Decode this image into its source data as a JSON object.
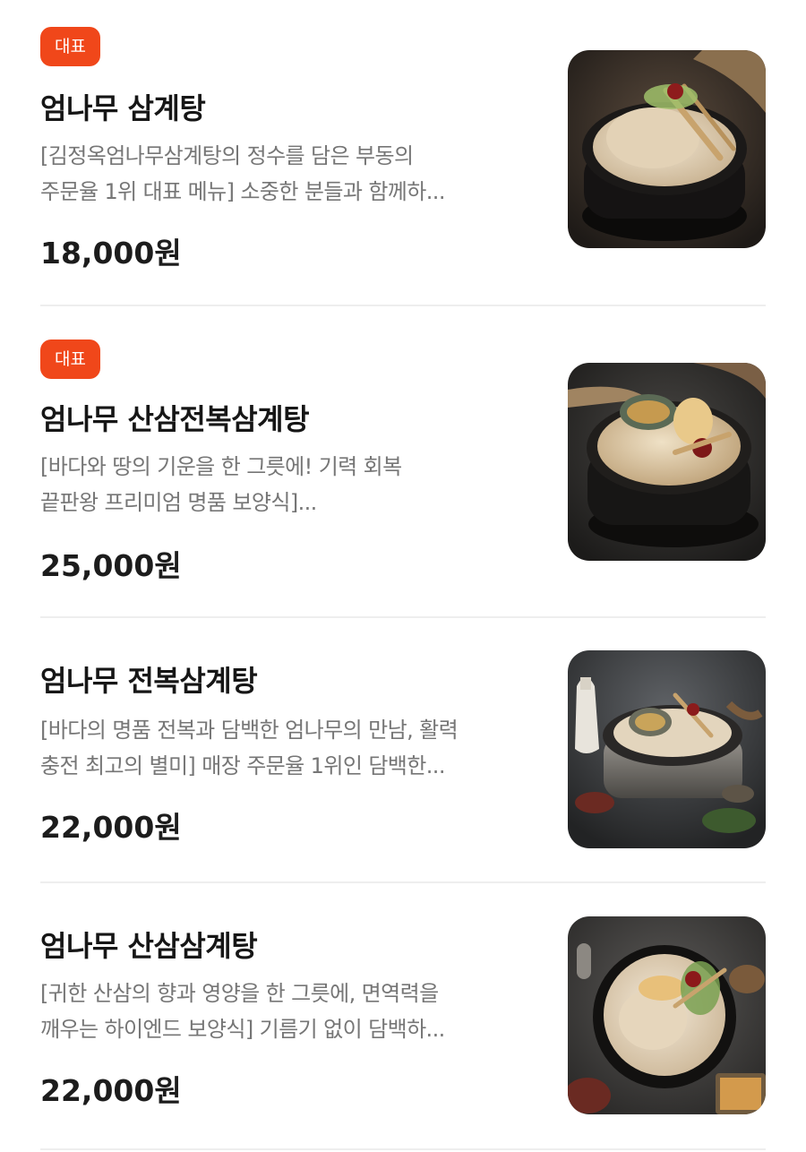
{
  "menu_items": [
    {
      "badge": "대표",
      "name": "엄나무 삼계탕",
      "desc_line1": "[김정옥엄나무삼계탕의 정수를 담은 부동의",
      "desc_line2": "주문율 1위 대표 메뉴] 소중한 분들과 함께하...",
      "price": "18,000원",
      "image_icon": "samgyetang-bowl-photo"
    },
    {
      "badge": "대표",
      "name": "엄나무 산삼전복삼계탕",
      "desc_line1": "[바다와 땅의 기운을 한 그릇에! 기력 회복",
      "desc_line2": "끝판왕 프리미엄 명품 보양식]...",
      "price": "25,000원",
      "image_icon": "abalone-ginseng-samgyetang-photo"
    },
    {
      "badge": "",
      "name": "엄나무 전복삼계탕",
      "desc_line1": "[바다의 명품 전복과 담백한 엄나무의 만남, 활력",
      "desc_line2": "충전 최고의 별미] 매장 주문율 1위인 담백한...",
      "price": "22,000원",
      "image_icon": "abalone-samgyetang-photo"
    },
    {
      "badge": "",
      "name": "엄나무 산삼삼계탕",
      "desc_line1": "[귀한 산삼의 향과 영양을 한 그릇에, 면역력을",
      "desc_line2": "깨우는 하이엔드 보양식] 기름기 없이 담백하...",
      "price": "22,000원",
      "image_icon": "ginseng-samgyetang-photo"
    }
  ],
  "colors": {
    "badge_bg": "#f0471a",
    "badge_text": "#ffffff",
    "title": "#161616",
    "description": "#767676",
    "price": "#1c1c1c",
    "divider": "#eeeeee"
  }
}
